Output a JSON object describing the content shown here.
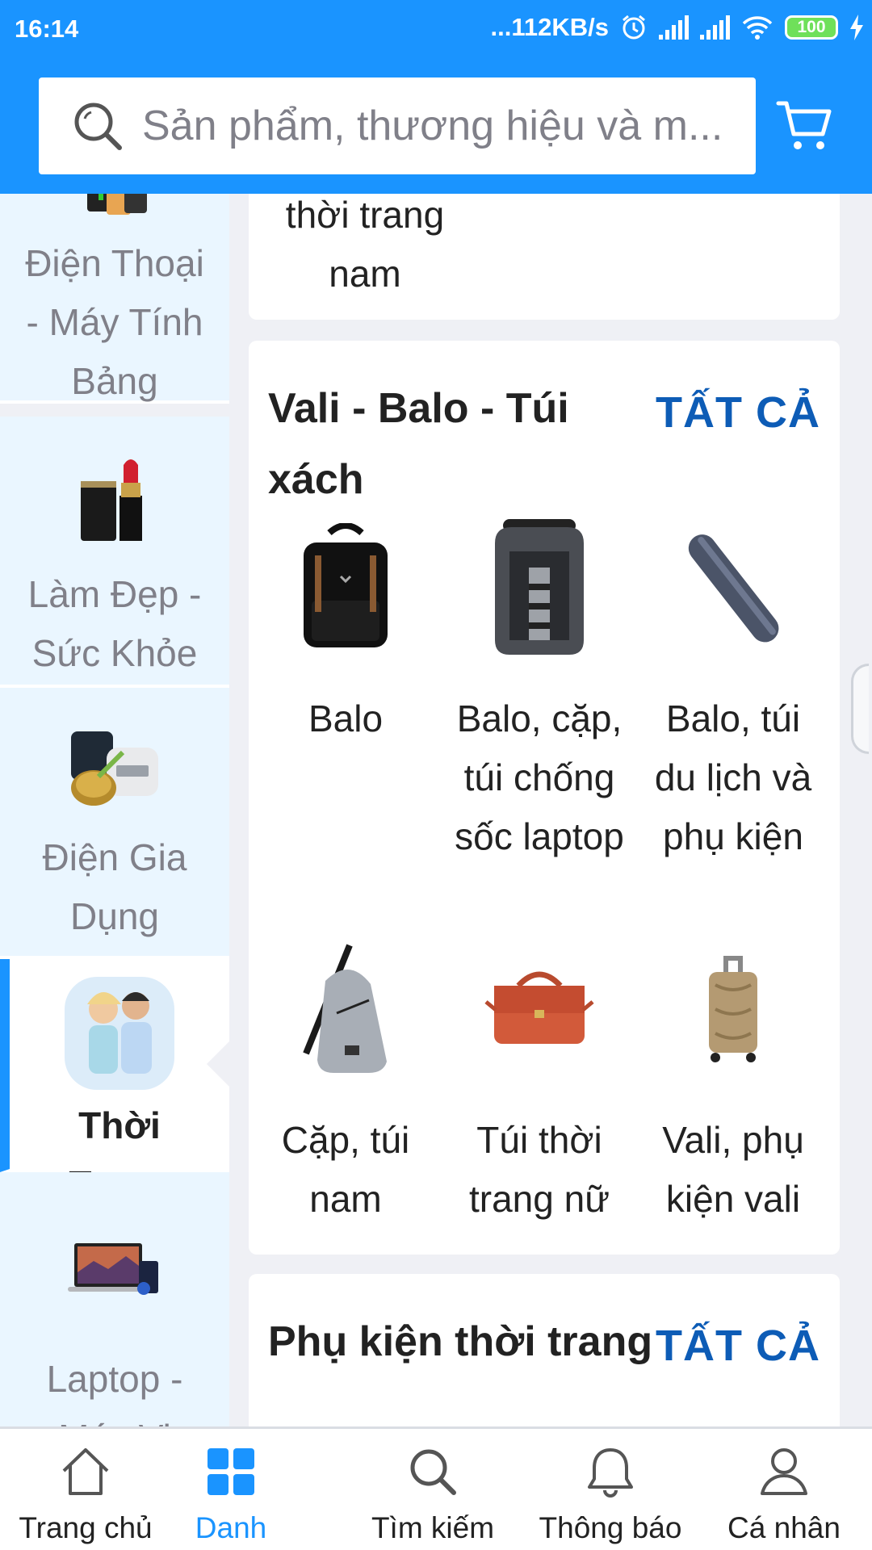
{
  "status_bar": {
    "time": "16:14",
    "network_speed": "...112KB/s",
    "battery": "100"
  },
  "header": {
    "search_placeholder": "Sản phẩm, thương hiệu và m...",
    "search_icon": "search-icon",
    "cart_icon": "cart-icon",
    "accent_color": "#1a94ff"
  },
  "sidebar": {
    "categories": [
      {
        "label": "Điện Thoại - Máy Tính Bảng",
        "icon": "phone-tablet-thumbnail",
        "active": false
      },
      {
        "label": "Làm Đẹp - Sức Khỏe",
        "icon": "cosmetics-thumbnail",
        "active": false
      },
      {
        "label": "Điện Gia Dụng",
        "icon": "appliance-thumbnail",
        "active": false
      },
      {
        "label": "Thời Trang",
        "icon": "fashion-thumbnail",
        "active": true
      },
      {
        "label": "Laptop - Máy Vi",
        "icon": "laptop-thumbnail",
        "active": false
      }
    ]
  },
  "main": {
    "prev_card_tail": "thời trang nam",
    "sections": [
      {
        "title": "Vali - Balo - Túi xách",
        "see_all": "TẤT CẢ",
        "items": [
          {
            "name": "Balo",
            "icon": "backpack-black-thumbnail"
          },
          {
            "name": "Balo, cặp, túi chống sốc laptop",
            "icon": "laptop-backpack-thumbnail"
          },
          {
            "name": "Balo, túi du lịch và phụ kiện",
            "icon": "travel-pouch-thumbnail"
          },
          {
            "name": "Cặp, túi nam",
            "icon": "sling-bag-thumbnail"
          },
          {
            "name": "Túi thời trang nữ",
            "icon": "handbag-thumbnail"
          },
          {
            "name": "Vali, phụ kiện vali",
            "icon": "suitcase-thumbnail"
          }
        ]
      },
      {
        "title": "Phụ kiện thời trang",
        "see_all": "TẤT CẢ"
      }
    ]
  },
  "bottom_nav": [
    {
      "label": "Trang chủ",
      "icon": "home-icon",
      "active": false
    },
    {
      "label": "Danh",
      "icon": "grid-icon",
      "active": true
    },
    {
      "label": "Tìm kiếm",
      "icon": "search-icon",
      "active": false
    },
    {
      "label": "Thông báo",
      "icon": "bell-icon",
      "active": false
    },
    {
      "label": "Cá nhân",
      "icon": "user-icon",
      "active": false
    }
  ]
}
